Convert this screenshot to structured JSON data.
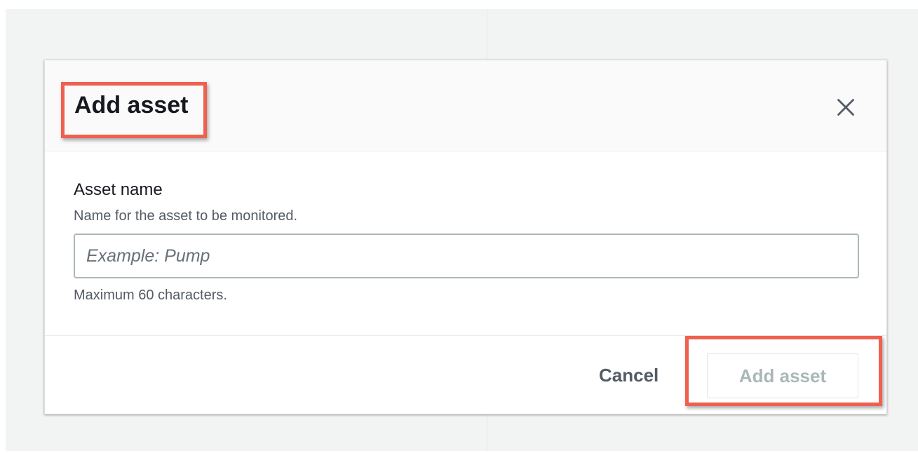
{
  "modal": {
    "title": "Add asset",
    "close_icon": "close-icon",
    "form": {
      "label": "Asset name",
      "description": "Name for the asset to be monitored.",
      "input_value": "",
      "input_placeholder": "Example: Pump",
      "constraint": "Maximum 60 characters."
    },
    "footer": {
      "cancel_label": "Cancel",
      "submit_label": "Add asset",
      "submit_disabled": true
    }
  },
  "colors": {
    "highlight": "#f0604f",
    "backdrop": "#f2f3f3",
    "text_primary": "#16191f",
    "text_secondary": "#545b64",
    "disabled_text": "#aab7b8"
  }
}
